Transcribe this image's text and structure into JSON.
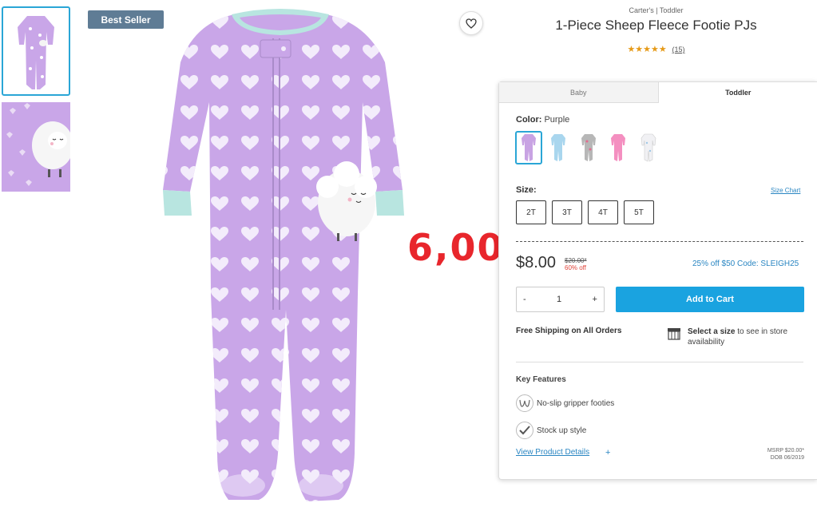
{
  "thumbnails": [
    {
      "name": "thumbnail-front",
      "selected": true
    },
    {
      "name": "thumbnail-detail",
      "selected": false
    }
  ],
  "image": {
    "badge": "Best Seller",
    "wishlist_icon": "heart-outline-icon"
  },
  "annotation": {
    "text": "6,00",
    "color": "#e8262c"
  },
  "product": {
    "breadcrumb": "Carter's | Toddler",
    "title": "1-Piece Sheep Fleece Footie PJs",
    "stars": "★★★★★",
    "review_count": "(15)"
  },
  "tabs": {
    "baby": "Baby",
    "toddler": "Toddler",
    "active": "Toddler"
  },
  "color": {
    "label": "Color:",
    "selected": "Purple",
    "swatches": [
      {
        "name": "purple",
        "hex": "#c8a3e3"
      },
      {
        "name": "light-blue",
        "hex": "#a9d6ee"
      },
      {
        "name": "gray-print",
        "hex": "#b7b7b7"
      },
      {
        "name": "pink",
        "hex": "#f48fc0"
      },
      {
        "name": "white-print",
        "hex": "#f1f1f4"
      }
    ]
  },
  "size": {
    "label": "Size:",
    "chart_link": "Size Chart",
    "options": [
      "2T",
      "3T",
      "4T",
      "5T"
    ]
  },
  "price": {
    "sale": "$8.00",
    "original": "$20.00*",
    "discount": "60% off",
    "promo": "25% off $50 Code: SLEIGH25"
  },
  "quantity": {
    "minus": "-",
    "value": "1",
    "plus": "+"
  },
  "cart": {
    "label": "Add to Cart",
    "color": "#1aa3e0"
  },
  "shipping": {
    "free": "Free Shipping on All Orders",
    "store_bold": "Select a size",
    "store_rest": " to see in store availability"
  },
  "features": {
    "title": "Key Features",
    "items": [
      {
        "icon": "gripper-icon",
        "label": "No-slip gripper footies"
      },
      {
        "icon": "checkmark-icon",
        "label": "Stock up style"
      }
    ],
    "view_details": "View Product Details",
    "view_plus": "+",
    "msrp": "MSRP $20.00*",
    "dob": "DOB 06/2019"
  }
}
